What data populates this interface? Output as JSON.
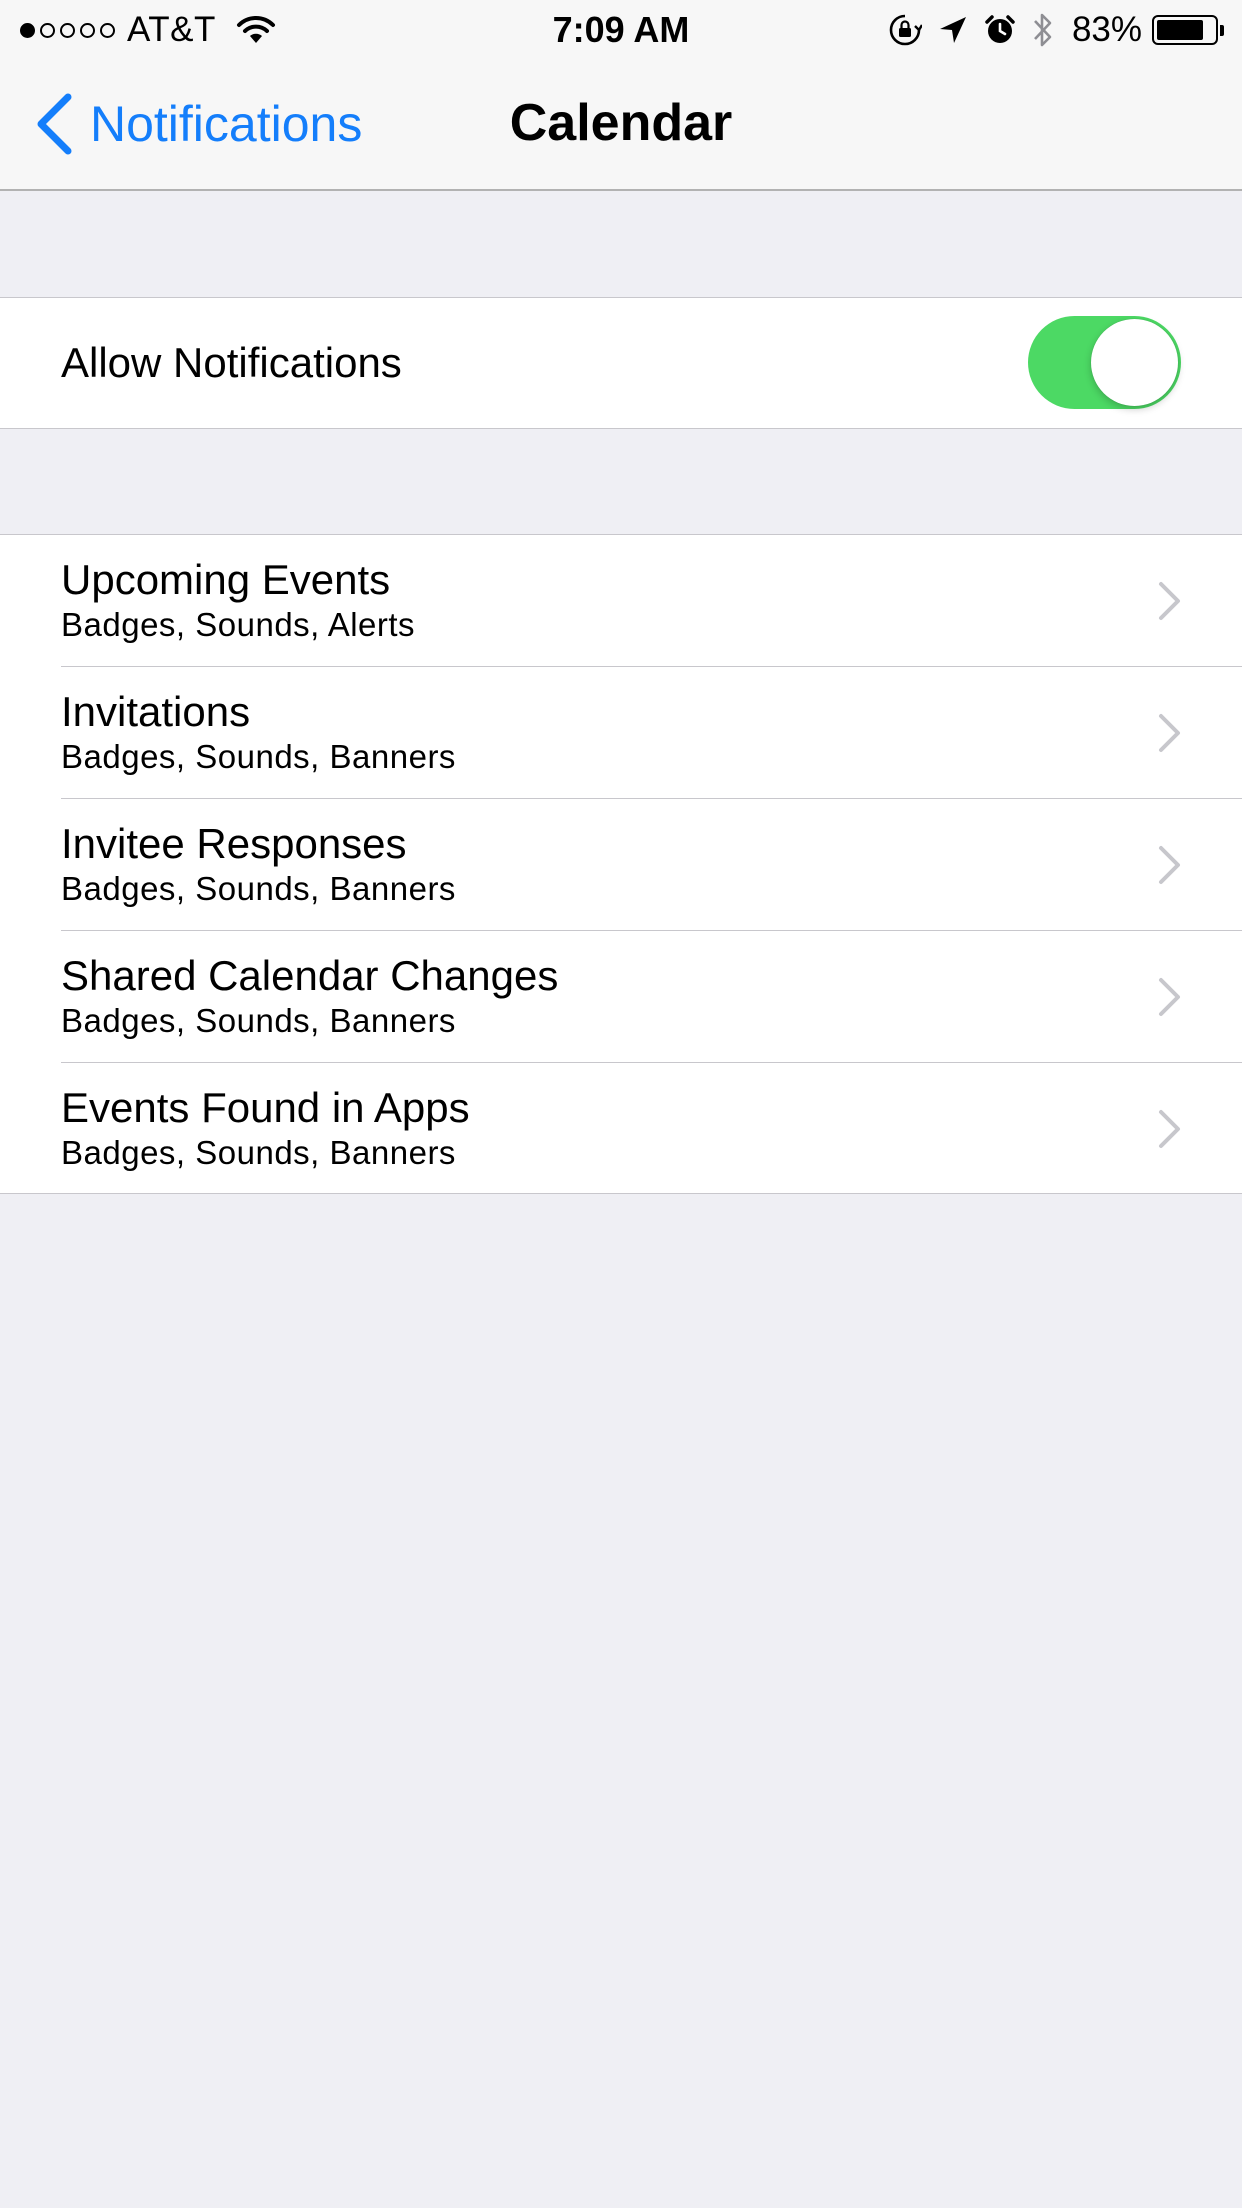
{
  "status_bar": {
    "signal_bars_filled": 1,
    "signal_bars_total": 5,
    "carrier": "AT&T",
    "time": "7:09 AM",
    "battery_percent_label": "83%",
    "battery_level": 0.83,
    "icons": [
      "wifi-icon",
      "rotation-lock-icon",
      "location-arrow-icon",
      "alarm-clock-icon",
      "bluetooth-icon",
      "battery-icon"
    ]
  },
  "nav": {
    "back_label": "Notifications",
    "title": "Calendar"
  },
  "allow": {
    "label": "Allow Notifications",
    "enabled": true,
    "toggle_color": "#4cd964"
  },
  "rows": [
    {
      "title": "Upcoming Events",
      "subtitle": "Badges, Sounds, Alerts"
    },
    {
      "title": "Invitations",
      "subtitle": "Badges, Sounds, Banners"
    },
    {
      "title": "Invitee Responses",
      "subtitle": "Badges, Sounds, Banners"
    },
    {
      "title": "Shared Calendar Changes",
      "subtitle": "Badges, Sounds, Banners"
    },
    {
      "title": "Events Found in Apps",
      "subtitle": "Badges, Sounds, Banners"
    }
  ],
  "colors": {
    "accent": "#147efb",
    "background": "#efeff4",
    "separator": "#c8c7cc",
    "chevron": "#c7c7cc"
  }
}
